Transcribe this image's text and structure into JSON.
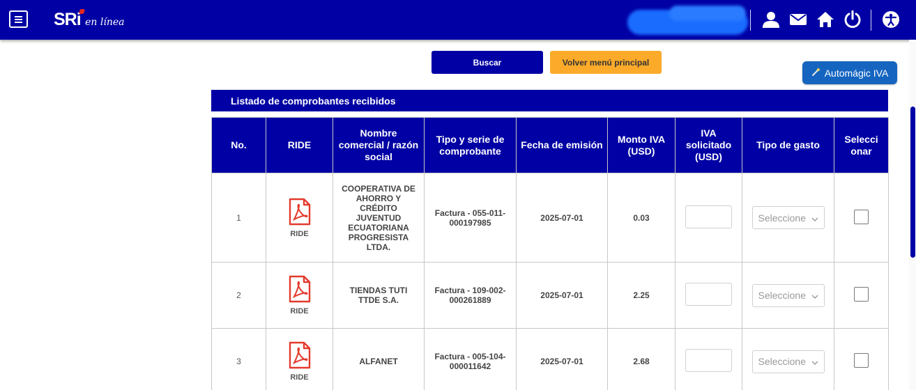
{
  "header": {
    "logo_main": "SRi",
    "logo_sub": "en línea",
    "icons": [
      "menu-icon",
      "user-icon",
      "mail-icon",
      "home-icon",
      "power-icon",
      "accessibility-icon"
    ],
    "color": "#0000a4"
  },
  "actions": {
    "buscar": "Buscar",
    "volver": "Volver menú principal",
    "automagic": "Automágic IVA",
    "automagic_icon": "magic-wand-icon"
  },
  "list": {
    "title": "Listado de comprobantes recibidos",
    "columns": {
      "no": "No.",
      "ride": "RIDE",
      "nombre": "Nombre comercial / razón social",
      "tipo": "Tipo y serie de comprobante",
      "fecha": "Fecha de emisión",
      "monto": "Monto IVA (USD)",
      "solicitado": "IVA solicitado (USD)",
      "gasto": "Tipo de gasto",
      "seleccionar": "Selecci onar"
    },
    "rows": [
      {
        "no": "1",
        "ride": "RIDE",
        "nombre": "COOPERATIVA DE AHORRO Y CRÉDITO JUVENTUD ECUATORIANA PROGRESISTA LTDA.",
        "tipo": "Factura - 055-011-000197985",
        "fecha": "2025-07-01",
        "monto": "0.03",
        "gasto_placeholder": "Seleccione"
      },
      {
        "no": "2",
        "ride": "RIDE",
        "nombre": "TIENDAS TUTI TTDE S.A.",
        "tipo": "Factura - 109-002-000261889",
        "fecha": "2025-07-01",
        "monto": "2.25",
        "gasto_placeholder": "Seleccione"
      },
      {
        "no": "3",
        "ride": "RIDE",
        "nombre": "ALFANET",
        "tipo": "Factura - 005-104-000011642",
        "fecha": "2025-07-01",
        "monto": "2.68",
        "gasto_placeholder": "Seleccione"
      }
    ]
  }
}
